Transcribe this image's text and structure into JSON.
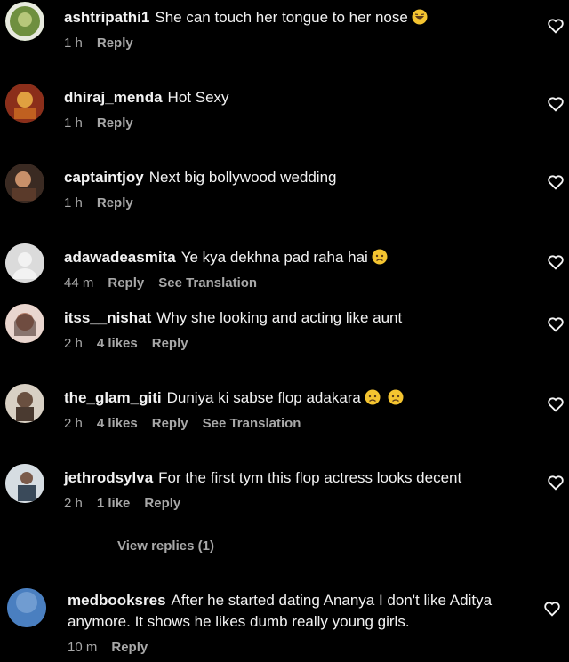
{
  "comments": [
    {
      "user": "ashtripathi1",
      "text": "She can touch her tongue to her nose",
      "emoji": "laugh",
      "time": "1 h",
      "likes": "",
      "reply": "Reply",
      "translation": "",
      "avatar": "#5a7a3a"
    },
    {
      "user": "dhiraj_menda",
      "text": "Hot Sexy",
      "emoji": "",
      "time": "1 h",
      "likes": "",
      "reply": "Reply",
      "translation": "",
      "avatar": "#a0522d"
    },
    {
      "user": "captaintjoy",
      "text": "Next big bollywood wedding",
      "emoji": "",
      "time": "1 h",
      "likes": "",
      "reply": "Reply",
      "translation": "",
      "avatar": "#6b4a3a"
    },
    {
      "user": "adawadeasmita",
      "text": "Ye kya dekhna pad raha hai",
      "emoji": "sad",
      "time": "44 m",
      "likes": "",
      "reply": "Reply",
      "translation": "See Translation",
      "avatar": "#dcdcdc"
    },
    {
      "user": "itss__nishat",
      "text": "Why she looking and acting like aunt",
      "emoji": "",
      "time": "2 h",
      "likes": "4 likes",
      "reply": "Reply",
      "translation": "",
      "avatar": "#b08070"
    },
    {
      "user": "the_glam_giti",
      "text": "Duniya ki sabse flop adakara",
      "emoji": "sad-sad",
      "time": "2 h",
      "likes": "4 likes",
      "reply": "Reply",
      "translation": "See Translation",
      "avatar": "#8a7a6a"
    },
    {
      "user": "jethrodsylva",
      "text": "For the first tym this flop actress looks decent",
      "emoji": "",
      "time": "2 h",
      "likes": "1 like",
      "reply": "Reply",
      "translation": "",
      "avatar": "#cfd6dc"
    },
    {
      "user": "medbooksres",
      "text": "After he started dating Ananya I don't like Aditya anymore. It shows he likes dumb really young girls.",
      "emoji": "",
      "time": "10 m",
      "likes": "",
      "reply": "Reply",
      "translation": "",
      "avatar": "#4a7fc0"
    }
  ],
  "view_replies": "View replies (1)"
}
